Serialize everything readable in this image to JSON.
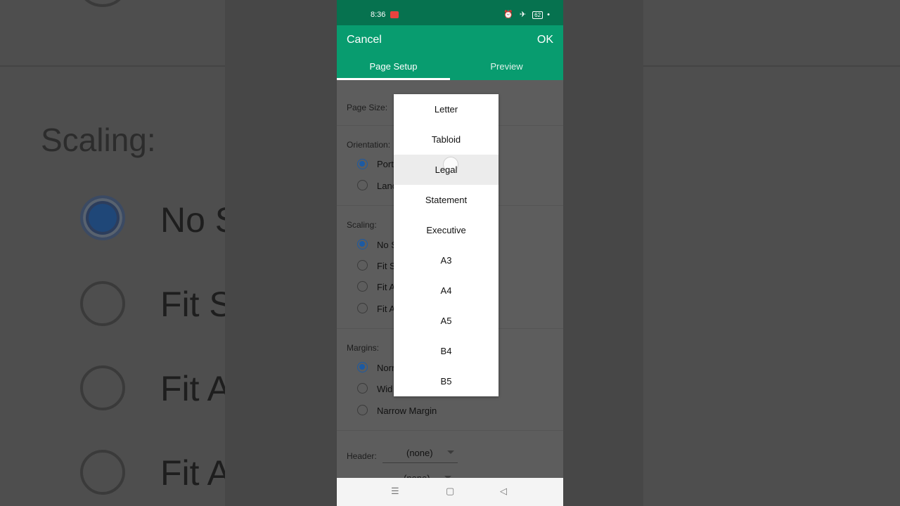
{
  "background": {
    "scaling_label": "Scaling:",
    "option_1": "No S",
    "option_2": "Fit S",
    "option_3": "Fit A",
    "option_4": "Fit A"
  },
  "status": {
    "time": "8:36",
    "battery": "62",
    "icons": "⏰ ✈"
  },
  "appbar": {
    "cancel": "Cancel",
    "ok": "OK",
    "tabs": [
      "Page Setup",
      "Preview"
    ],
    "active_tab": "Page Setup"
  },
  "page_size": {
    "label": "Page Size:"
  },
  "orientation": {
    "label": "Orientation:",
    "options": [
      "Port",
      "Lanc"
    ],
    "selected": 0
  },
  "scaling": {
    "label": "Scaling:",
    "options": [
      "No S",
      "Fit S",
      "Fit A",
      "Fit A"
    ],
    "selected": 0
  },
  "margins": {
    "label": "Margins:",
    "options": [
      "Norn",
      "Wid",
      "Narrow Margin"
    ],
    "selected": 0
  },
  "header": {
    "label": "Header:",
    "value": "(none)"
  },
  "footer": {
    "value": "(none)"
  },
  "page_size_menu": {
    "items": [
      "Letter",
      "Tabloid",
      "Legal",
      "Statement",
      "Executive",
      "A3",
      "A4",
      "A5",
      "B4",
      "B5"
    ],
    "highlighted": "Legal"
  },
  "navbar": {
    "recents": "☰",
    "home": "▢",
    "back": "◁"
  },
  "colors": {
    "appbar": "#089c6f",
    "statusbar": "#06724f",
    "radio_on": "#1c5aa3"
  }
}
